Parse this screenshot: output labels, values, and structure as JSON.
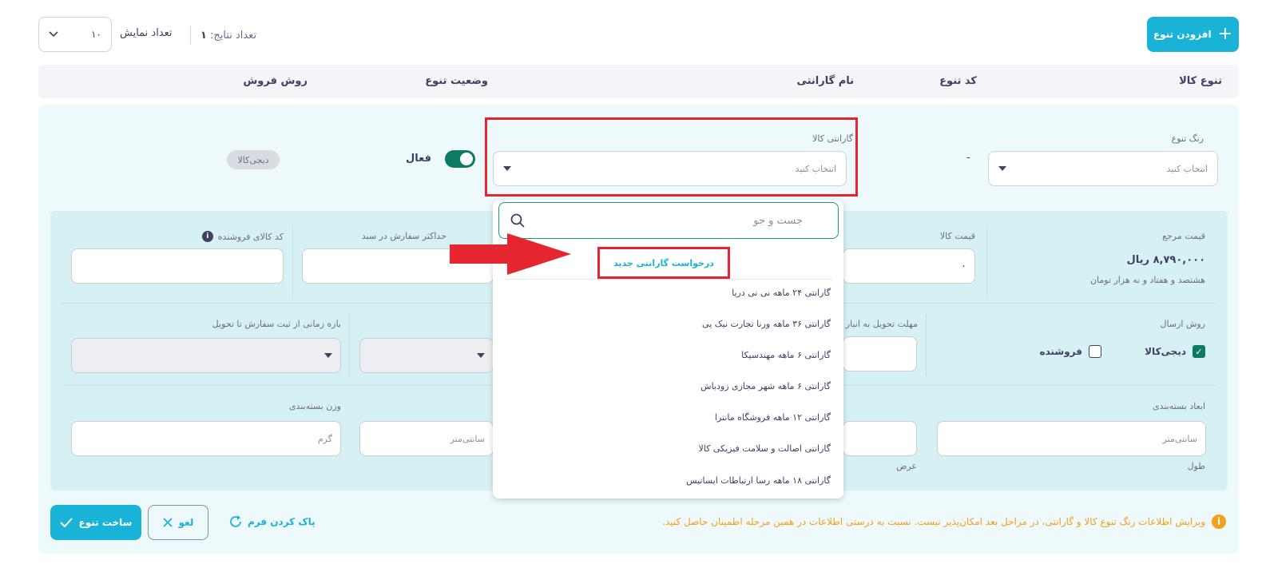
{
  "toolbar": {
    "add_variant_label": "افزودن تنوع",
    "results_label": "تعداد نتایج:",
    "results_count": "۱",
    "display_count_label": "تعداد نمایش",
    "per_page_value": "۱۰"
  },
  "table_header": {
    "columns": [
      "تنوع کالا",
      "کد تنوع",
      "نام گارانتی",
      "وضعیت تنوع",
      "روش فروش"
    ]
  },
  "variant_row": {
    "color_label": "رنگ تنوع",
    "color_placeholder": "انتخاب کنید",
    "code_value": "-",
    "warranty_label": "گارانتی کالا",
    "warranty_placeholder": "انتخاب کنید",
    "status_label": "فعال",
    "sale_method_badge": "دیجی‌کالا"
  },
  "dropdown": {
    "search_placeholder": "جست و جو",
    "new_warranty_label": "درخواست گارانتی جدید",
    "options": [
      "گارانتی ۲۴ ماهه نی نی دریا",
      "گارانتی ۳۶ ماهه ورنا تجارت نیک پی",
      "گارانتی ۶ ماهه مهندسیکا",
      "گارانتی ۶ ماهه شهر مجازی زودباش",
      "گارانتی ۱۲ ماهه فروشگاه مانترا",
      "گارانتی اصالت و سلامت فیزیکی کالا",
      "گارانتی ۱۸ ماهه رسا ارتباطات ایساتیس"
    ]
  },
  "details": {
    "ref_price_label": "قیمت مرجع",
    "ref_price_value": "۸,۷۹۰,۰۰۰ ریال",
    "ref_price_words": "هشتصد و هفتاد و نه هزار تومان",
    "price_label": "قیمت کالا",
    "price_value": "۰",
    "max_order_label": "حداکثر سفارش در سبد",
    "seller_code_label": "کد کالای فروشنده",
    "shipping_label": "روش ارسال",
    "shipping_digikala": "دیجی‌کالا",
    "shipping_seller": "فروشنده",
    "delivery_deadline_label": "مهلت تحویل به انبار",
    "delivery_range_label": "بازه زمانی از ثبت سفارش تا تحویل",
    "package_dims_label": "ابعاد بسته‌بندی",
    "length_label": "طول",
    "width_label": "عرض",
    "cm_placeholder": "سانتی‌متر",
    "package_weight_label": "وزن بسته‌بندی",
    "gram_placeholder": "گرم"
  },
  "actions": {
    "create_label": "ساخت تنوع",
    "cancel_label": "لغو",
    "clear_label": "پاک کردن فرم",
    "warning_text": "ویرایش اطلاعات رنگ تنوع کالا و گارانتی، در مراحل بعد امکان‌پذیر نیست. نسبت به درستی اطلاعات در همین مرحله اطمینان حاصل کنید."
  },
  "colors": {
    "accent": "#1ab3d8",
    "toggle": "#0f7a64",
    "highlight": "#e52530",
    "warning": "#f5a01a"
  }
}
